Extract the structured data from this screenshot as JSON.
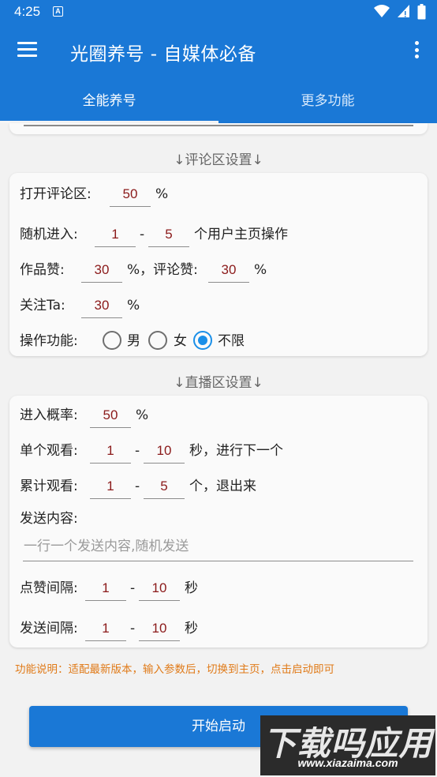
{
  "status_bar": {
    "time": "4:25",
    "notif_glyph": "A"
  },
  "app_bar": {
    "title": "光圈养号 - 自媒体必备"
  },
  "tabs": [
    {
      "label": "全能养号",
      "selected": true
    },
    {
      "label": "更多功能",
      "selected": false
    }
  ],
  "comment_section": {
    "title": "↓评论区设置↓",
    "open_label": "打开评论区:",
    "open_value": "50",
    "percent": "%",
    "random_enter_label": "随机进入:",
    "random_enter_min": "1",
    "dash": "-",
    "random_enter_max": "5",
    "random_enter_suffix": "个用户主页操作",
    "work_like_label": "作品赞:",
    "work_like_value": "30",
    "comment_like_label": "%，评论赞:",
    "comment_like_value": "30",
    "follow_label": "关注Ta:",
    "follow_value": "30",
    "function_label": "操作功能:",
    "options": [
      "男",
      "女",
      "不限"
    ],
    "selected_option": "不限"
  },
  "live_section": {
    "title": "↓直播区设置↓",
    "enter_rate_label": "进入概率:",
    "enter_rate_value": "50",
    "percent": "%",
    "single_watch_label": "单个观看:",
    "single_watch_min": "1",
    "dash": "-",
    "single_watch_max": "10",
    "single_watch_suffix": "秒，进行下一个",
    "total_watch_label": "累计观看:",
    "total_watch_min": "1",
    "total_watch_max": "5",
    "total_watch_suffix": "个，退出来",
    "send_content_label": "发送内容:",
    "send_content_placeholder": "一行一个发送内容,随机发送",
    "like_interval_label": "点赞间隔:",
    "like_interval_min": "1",
    "like_interval_max": "10",
    "second": "秒",
    "send_interval_label": "发送间隔:",
    "send_interval_min": "1",
    "send_interval_max": "10"
  },
  "note": "功能说明：适配最新版本，输入参数后，切换到主页，点击启动即可",
  "start_button": "开始启动",
  "watermark": {
    "title": "下载吗应用",
    "url": "www.xiazaima.com"
  },
  "colors": {
    "primary": "#1a78d6",
    "value_text": "#8b1a1a",
    "note_text": "#e07a18",
    "radio_checked": "#1a8fe8"
  }
}
